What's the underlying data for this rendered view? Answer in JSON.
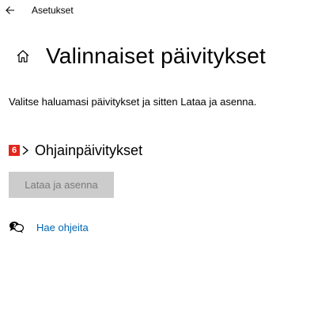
{
  "window": {
    "title": "Asetukset"
  },
  "page": {
    "title": "Valinnaiset päivitykset",
    "description": "Valitse haluamasi päivitykset ja sitten Lataa ja asenna."
  },
  "section": {
    "badge": "6",
    "title": "Ohjainpäivitykset"
  },
  "actions": {
    "install_label": "Lataa ja asenna",
    "install_enabled": false
  },
  "help": {
    "label": "Hae ohjeita"
  },
  "colors": {
    "badge": "#e1261c",
    "link": "#0066b4",
    "disabled_button_bg": "#cccccc",
    "disabled_button_text": "#7a7a7a"
  },
  "icons": {
    "back": "back-arrow-icon",
    "home": "home-icon",
    "expand": "chevron-right-icon",
    "help": "help-chat-icon"
  }
}
